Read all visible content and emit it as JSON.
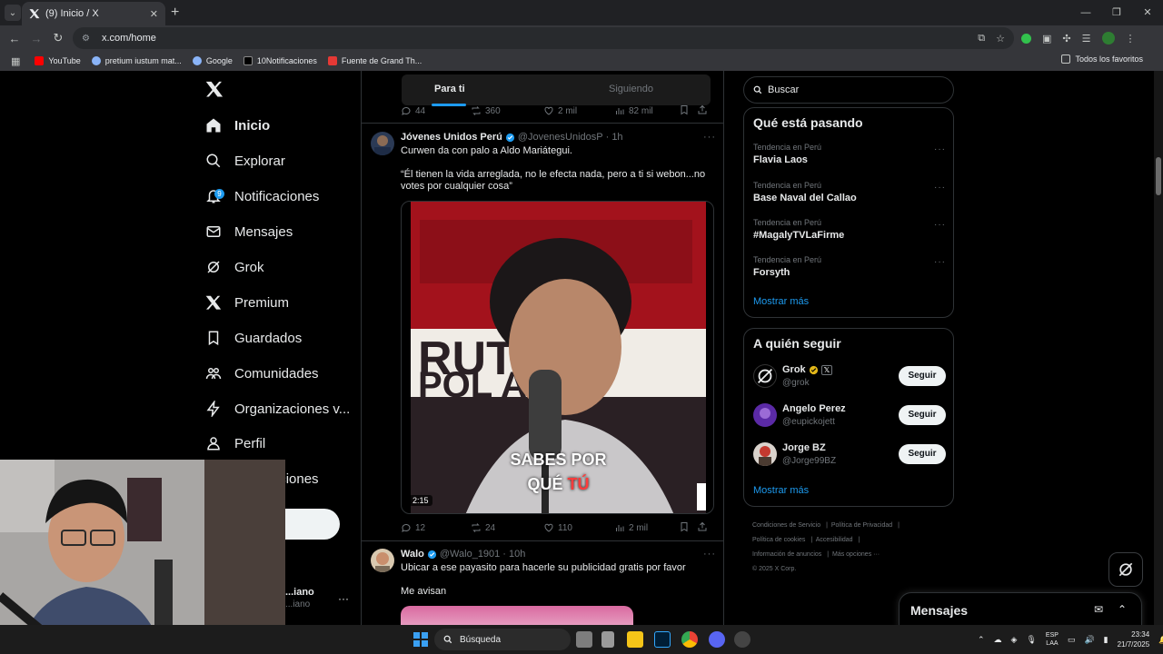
{
  "browser": {
    "tab_title": "(9) Inicio / X",
    "url": "x.com/home",
    "bookmarks": [
      {
        "label": "YouTube",
        "color": "#ff0000"
      },
      {
        "label": "pretium iustum mat...",
        "color": "#8ab4f8"
      },
      {
        "label": "Google",
        "color": "#8ab4f8"
      },
      {
        "label": "10Notificaciones",
        "color": "#000000"
      },
      {
        "label": "Fuente de Grand Th...",
        "color": "#e53935"
      }
    ],
    "all_bookmarks": "Todos los favoritos"
  },
  "nav": {
    "items": [
      {
        "label": "Inicio",
        "icon": "home-icon"
      },
      {
        "label": "Explorar",
        "icon": "search-icon"
      },
      {
        "label": "Notificaciones",
        "icon": "bell-icon",
        "badge": "9"
      },
      {
        "label": "Mensajes",
        "icon": "envelope-icon"
      },
      {
        "label": "Grok",
        "icon": "grok-icon"
      },
      {
        "label": "Premium",
        "icon": "x-logo-icon"
      },
      {
        "label": "Guardados",
        "icon": "bookmark-icon"
      },
      {
        "label": "Comunidades",
        "icon": "people-icon"
      },
      {
        "label": "Organizaciones v...",
        "icon": "lightning-icon"
      },
      {
        "label": "Perfil",
        "icon": "person-icon"
      },
      {
        "label": "Más opciones",
        "icon": "more-icon"
      }
    ],
    "account_name": "...iano",
    "account_handle": "...iano"
  },
  "feed": {
    "tabs": {
      "for_you": "Para ti",
      "following": "Siguiendo"
    },
    "prev_actions": {
      "replies": "44",
      "reposts": "360",
      "likes": "2 mil",
      "views": "82 mil"
    },
    "post1": {
      "name": "Jóvenes Unidos Perú",
      "handle": "@JovenesUnidosP",
      "time": "· 1h",
      "text1": "Curwen da con palo a Aldo Mariátegui.",
      "text2": "“Él tienen la vida arreglada, no le efecta nada, pero a ti si webon...no votes por cualquier cosa”",
      "duration": "2:15",
      "caption_line1": "SABES POR",
      "caption_line2a": "QUÉ",
      "caption_line2b": "TÚ",
      "actions": {
        "replies": "12",
        "reposts": "24",
        "likes": "110",
        "views": "2 mil"
      }
    },
    "post2": {
      "name": "Walo",
      "handle": "@Walo_1901",
      "time": "· 10h",
      "text1": "Ubicar a ese payasito para hacerle su publicidad gratis por favor",
      "text2": "Me avisan"
    }
  },
  "sidebar": {
    "search_placeholder": "Buscar",
    "trends_title": "Qué está pasando",
    "trends": [
      {
        "context": "Tendencia en Perú",
        "topic": "Flavia Laos"
      },
      {
        "context": "Tendencia en Perú",
        "topic": "Base Naval del Callao"
      },
      {
        "context": "Tendencia en Perú",
        "topic": "#MagalyTVLaFirme"
      },
      {
        "context": "Tendencia en Perú",
        "topic": "Forsyth"
      }
    ],
    "show_more": "Mostrar más",
    "follow_title": "A quién seguir",
    "follow": [
      {
        "name": "Grok",
        "handle": "@grok",
        "button": "Seguir"
      },
      {
        "name": "Angelo Perez",
        "handle": "@eupickojett",
        "button": "Seguir"
      },
      {
        "name": "Jorge BZ",
        "handle": "@Jorge99BZ",
        "button": "Seguir"
      }
    ],
    "footer": {
      "terms": "Condiciones de Servicio",
      "privacy": "Política de Privacidad",
      "cookies": "Política de cookies",
      "accessibility": "Accesibilidad",
      "ads": "Información de anuncios",
      "more": "Más opciones ···",
      "copyright": "© 2025 X Corp."
    }
  },
  "messages_drawer": {
    "title": "Mensajes"
  },
  "taskbar": {
    "search": "Búsqueda",
    "lang1": "ESP",
    "lang2": "LAA",
    "time": "23:34",
    "date": "21/7/2025"
  }
}
